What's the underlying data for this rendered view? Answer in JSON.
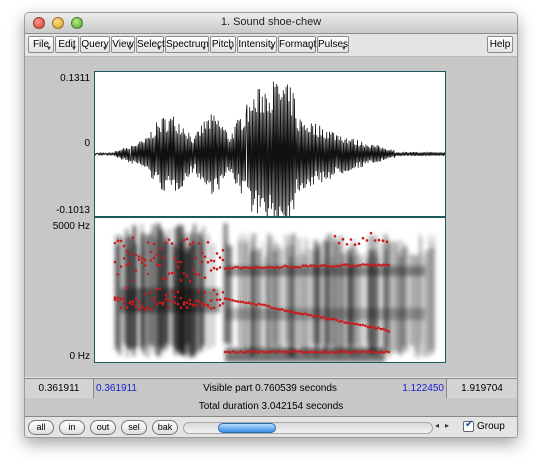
{
  "window": {
    "title": "1. Sound shoe-chew"
  },
  "menu": {
    "items": [
      {
        "label": "File"
      },
      {
        "label": "Edit"
      },
      {
        "label": "Query"
      },
      {
        "label": "View"
      },
      {
        "label": "Select"
      },
      {
        "label": "Spectrum"
      },
      {
        "label": "Pitch"
      },
      {
        "label": "Intensity"
      },
      {
        "label": "Formant"
      },
      {
        "label": "Pulses"
      }
    ],
    "help": "Help"
  },
  "waveform": {
    "y_top": "0.1311",
    "y_mid": "0",
    "y_bottom": "-0.1013"
  },
  "spectrogram": {
    "y_top": "5000 Hz",
    "y_bottom": "0 Hz",
    "formant_color": "#cc1a1a"
  },
  "info": {
    "window_start": "0.361911",
    "visible_start": "0.361911",
    "visible_text": "Visible part 0.760539 seconds",
    "visible_end": "1.122450",
    "window_end": "1.919704",
    "total": "Total duration 3.042154 seconds"
  },
  "buttons": {
    "all": "all",
    "in": "in",
    "out": "out",
    "sel": "sel",
    "bak": "bak"
  },
  "scroll": {
    "left_arrow": "◂",
    "right_arrow": "▸"
  },
  "group": {
    "label": "Group",
    "checked": true
  },
  "colors": {
    "panel_border": "#1a5a5a",
    "time_blue": "#1a1ad0",
    "scroll_thumb": "#3b8fe4"
  }
}
